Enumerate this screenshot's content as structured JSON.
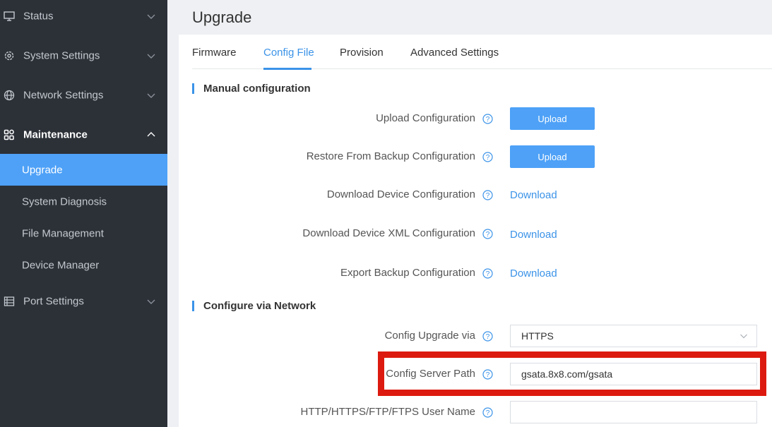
{
  "sidebar": {
    "items": [
      {
        "label": "Status",
        "icon": "monitor-icon"
      },
      {
        "label": "System Settings",
        "icon": "gear-icon"
      },
      {
        "label": "Network Settings",
        "icon": "globe-icon"
      },
      {
        "label": "Maintenance",
        "icon": "grid-icon"
      },
      {
        "label": "Port Settings",
        "icon": "port-icon"
      }
    ],
    "sub_items": [
      {
        "label": "Upgrade",
        "active": true
      },
      {
        "label": "System Diagnosis"
      },
      {
        "label": "File Management"
      },
      {
        "label": "Device Manager"
      }
    ]
  },
  "page": {
    "title": "Upgrade"
  },
  "tabs": [
    {
      "label": "Firmware"
    },
    {
      "label": "Config File",
      "active": true
    },
    {
      "label": "Provision"
    },
    {
      "label": "Advanced Settings"
    }
  ],
  "manual": {
    "heading": "Manual configuration",
    "upload_config_label": "Upload Configuration",
    "upload_config_button": "Upload",
    "restore_label": "Restore From Backup Configuration",
    "restore_button": "Upload",
    "download_device_label": "Download Device Configuration",
    "download_device_link": "Download",
    "download_xml_label": "Download Device XML Configuration",
    "download_xml_link": "Download",
    "export_label": "Export Backup Configuration",
    "export_link": "Download"
  },
  "network": {
    "heading": "Configure via Network",
    "upgrade_via_label": "Config Upgrade via",
    "upgrade_via_value": "HTTPS",
    "server_path_label": "Config Server Path",
    "server_path_value": "gsata.8x8.com/gsata",
    "user_name_label": "HTTP/HTTPS/FTP/FTPS User Name",
    "user_name_value": ""
  },
  "colors": {
    "accent": "#4ea1f7",
    "link": "#3b93e8",
    "sidebar_bg": "#2c3138",
    "highlight": "#dd1a0f"
  }
}
